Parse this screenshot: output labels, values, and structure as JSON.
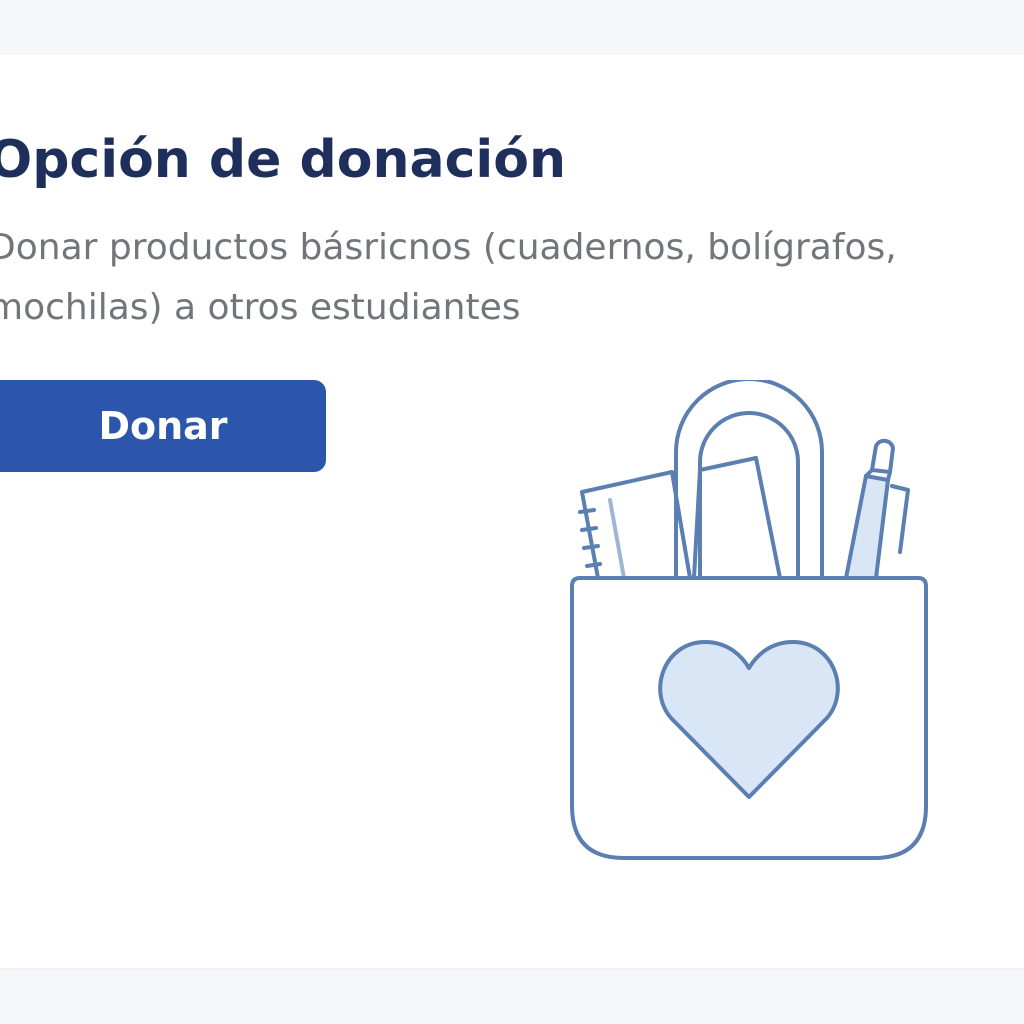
{
  "donation": {
    "title": "Opción de donación",
    "description": "Donar productos básricnos (cuadernos, bolígrafos, mochilas) a otros estudiantes",
    "button_label": "Donar",
    "illustration_icon": "tote-bag-heart-icon"
  },
  "colors": {
    "background": "#f6f7f9",
    "card": "#ffffff",
    "title": "#1d2f5a",
    "description": "#72757a",
    "button": "#2b56ab",
    "button_text": "#ffffff",
    "icon_stroke": "#5a7fb0",
    "icon_fill": "#d9e6f6"
  }
}
